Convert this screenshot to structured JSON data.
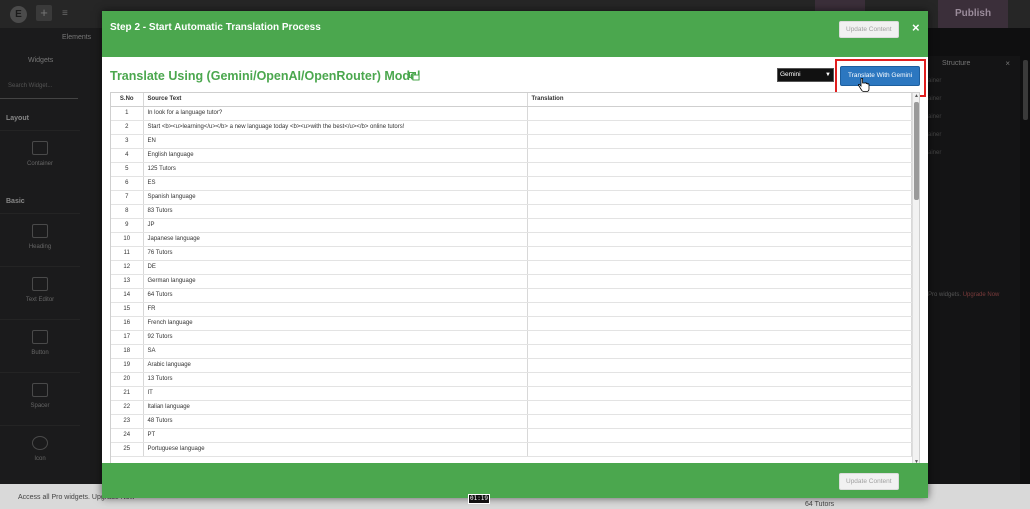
{
  "background": {
    "publish_label": "Publish",
    "sidebar": {
      "tab_widgets": "Widgets",
      "tab_elements": "Elements",
      "search_placeholder": "Search Widget...",
      "section_layout": "Layout",
      "section_basic": "Basic",
      "widgets": [
        "Container",
        "Heading",
        "Text Editor",
        "Button",
        "Spacer",
        "Icon"
      ]
    },
    "structure_panel": {
      "title": "Structure",
      "items": [
        "ainer",
        "ainer",
        "ainer",
        "ainer",
        "ainer"
      ],
      "pro_text": "Pro widgets.",
      "pro_link": "Upgrade Now"
    },
    "bottom_bar_text": "Access all Pro widgets. Upgrade Now",
    "bottom_right_text": "64 Tutors"
  },
  "modal": {
    "header_title": "Step 2 - Start Automatic Translation Process",
    "update_content_label": "Update Content",
    "close_glyph": "×",
    "subtitle": "Translate Using (Gemini/OpenAI/OpenRouter) Model",
    "model_select_value": "Gemini",
    "translate_button_label": "Translate With Gemini",
    "footer_update_label": "Update Content",
    "accent_color": "#4ba74e",
    "button_color": "#2c77c0",
    "highlight_color": "#e01e1e"
  },
  "table": {
    "headers": {
      "sno": "S.No",
      "source": "Source Text",
      "translation": "Translation"
    },
    "rows": [
      {
        "sno": "1",
        "source": "In look for a language tutor?",
        "translation": ""
      },
      {
        "sno": "2",
        "source": "Start <b><u>learning</u></b> a new language today <b><u>with the best</u></b> online tutors!",
        "translation": ""
      },
      {
        "sno": "3",
        "source": "EN",
        "translation": ""
      },
      {
        "sno": "4",
        "source": "English language",
        "translation": ""
      },
      {
        "sno": "5",
        "source": "125 Tutors",
        "translation": ""
      },
      {
        "sno": "6",
        "source": "ES",
        "translation": ""
      },
      {
        "sno": "7",
        "source": "Spanish language",
        "translation": ""
      },
      {
        "sno": "8",
        "source": "83 Tutors",
        "translation": ""
      },
      {
        "sno": "9",
        "source": "JP",
        "translation": ""
      },
      {
        "sno": "10",
        "source": "Japanese language",
        "translation": ""
      },
      {
        "sno": "11",
        "source": "76 Tutors",
        "translation": ""
      },
      {
        "sno": "12",
        "source": "DE",
        "translation": ""
      },
      {
        "sno": "13",
        "source": "German language",
        "translation": ""
      },
      {
        "sno": "14",
        "source": "64 Tutors",
        "translation": ""
      },
      {
        "sno": "15",
        "source": "FR",
        "translation": ""
      },
      {
        "sno": "16",
        "source": "French language",
        "translation": ""
      },
      {
        "sno": "17",
        "source": "92 Tutors",
        "translation": ""
      },
      {
        "sno": "18",
        "source": "SA",
        "translation": ""
      },
      {
        "sno": "19",
        "source": "Arabic language",
        "translation": ""
      },
      {
        "sno": "20",
        "source": "13 Tutors",
        "translation": ""
      },
      {
        "sno": "21",
        "source": "IT",
        "translation": ""
      },
      {
        "sno": "22",
        "source": "Italian language",
        "translation": ""
      },
      {
        "sno": "23",
        "source": "48 Tutors",
        "translation": ""
      },
      {
        "sno": "24",
        "source": "PT",
        "translation": ""
      },
      {
        "sno": "25",
        "source": "Portuguese language",
        "translation": ""
      }
    ]
  },
  "video_timestamp": "01:19"
}
